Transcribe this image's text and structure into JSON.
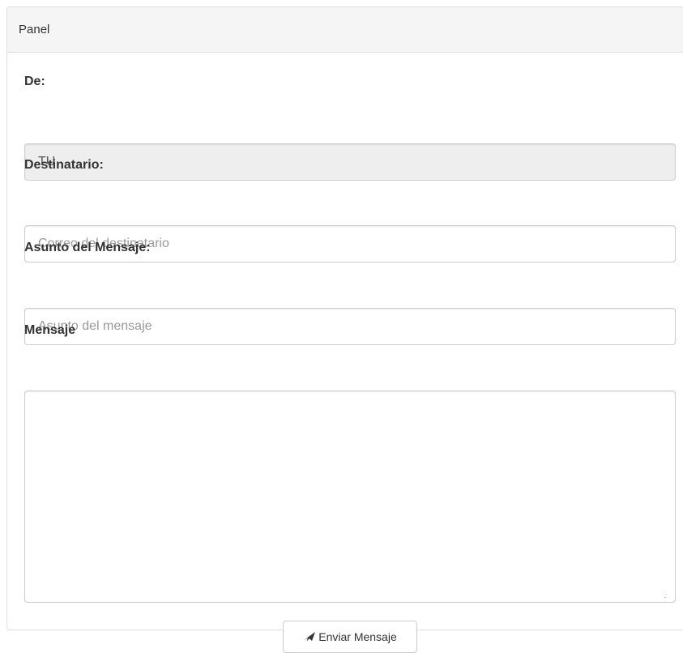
{
  "panel": {
    "heading": "Panel"
  },
  "form": {
    "from_label": "De:",
    "from_value": "TU",
    "recipient_label": "Destinatario:",
    "recipient_placeholder": "Correo del destinatario",
    "recipient_value": "",
    "subject_label": "Asunto del Mensaje:",
    "subject_placeholder": "Asunto del mensaje",
    "subject_value": "",
    "message_label": "Mensaje",
    "message_value": "",
    "send_label": "Enviar Mensaje",
    "send_icon": "send-icon"
  }
}
